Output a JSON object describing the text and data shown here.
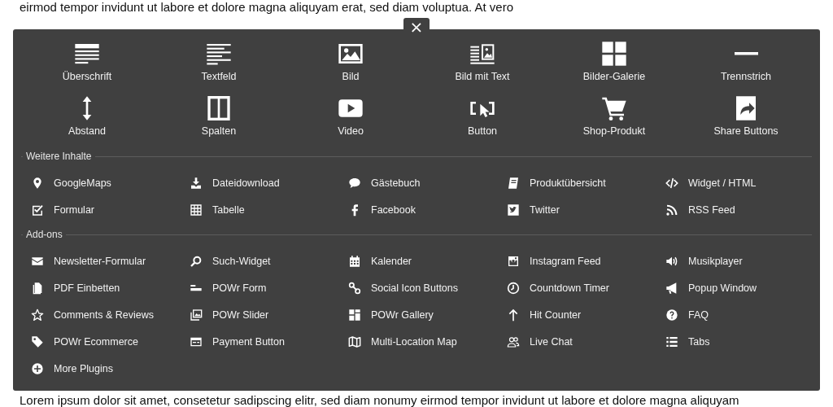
{
  "page_text_top": "eirmod tempor invidunt ut labore et dolore magna aliquyam erat, sed diam voluptua. At vero",
  "close_button": "×",
  "elements": [
    {
      "label": "Überschrift"
    },
    {
      "label": "Textfeld"
    },
    {
      "label": "Bild"
    },
    {
      "label": "Bild mit Text"
    },
    {
      "label": "Bilder-Galerie"
    },
    {
      "label": "Trennstrich"
    },
    {
      "label": "Abstand"
    },
    {
      "label": "Spalten"
    },
    {
      "label": "Video"
    },
    {
      "label": "Button"
    },
    {
      "label": "Shop-Produkt"
    },
    {
      "label": "Share Buttons"
    }
  ],
  "sections": [
    {
      "title": "Weitere Inhalte",
      "items": [
        {
          "label": "GoogleMaps"
        },
        {
          "label": "Dateidownload"
        },
        {
          "label": "Gästebuch"
        },
        {
          "label": "Produktübersicht"
        },
        {
          "label": "Widget / HTML"
        },
        {
          "label": "Formular"
        },
        {
          "label": "Tabelle"
        },
        {
          "label": "Facebook"
        },
        {
          "label": "Twitter"
        },
        {
          "label": "RSS Feed"
        }
      ]
    },
    {
      "title": "Add-ons",
      "items": [
        {
          "label": "Newsletter-Formular"
        },
        {
          "label": "Such-Widget"
        },
        {
          "label": "Kalender"
        },
        {
          "label": "Instagram Feed"
        },
        {
          "label": "Musikplayer"
        },
        {
          "label": "PDF Einbetten"
        },
        {
          "label": "POWr Form"
        },
        {
          "label": "Social Icon Buttons"
        },
        {
          "label": "Countdown Timer"
        },
        {
          "label": "Popup Window"
        },
        {
          "label": "Comments & Reviews"
        },
        {
          "label": "POWr Slider"
        },
        {
          "label": "POWr Gallery"
        },
        {
          "label": "Hit Counter"
        },
        {
          "label": "FAQ"
        },
        {
          "label": "POWr Ecommerce"
        },
        {
          "label": "Payment Button"
        },
        {
          "label": "Multi-Location Map"
        },
        {
          "label": "Live Chat"
        },
        {
          "label": "Tabs"
        },
        {
          "label": "More Plugins"
        }
      ]
    }
  ],
  "page_text_bottom": "Lorem ipsum dolor sit amet, consetetur sadipscing elitr, sed diam nonumy eirmod tempor invidunt ut labore et dolore magna aliquyam"
}
